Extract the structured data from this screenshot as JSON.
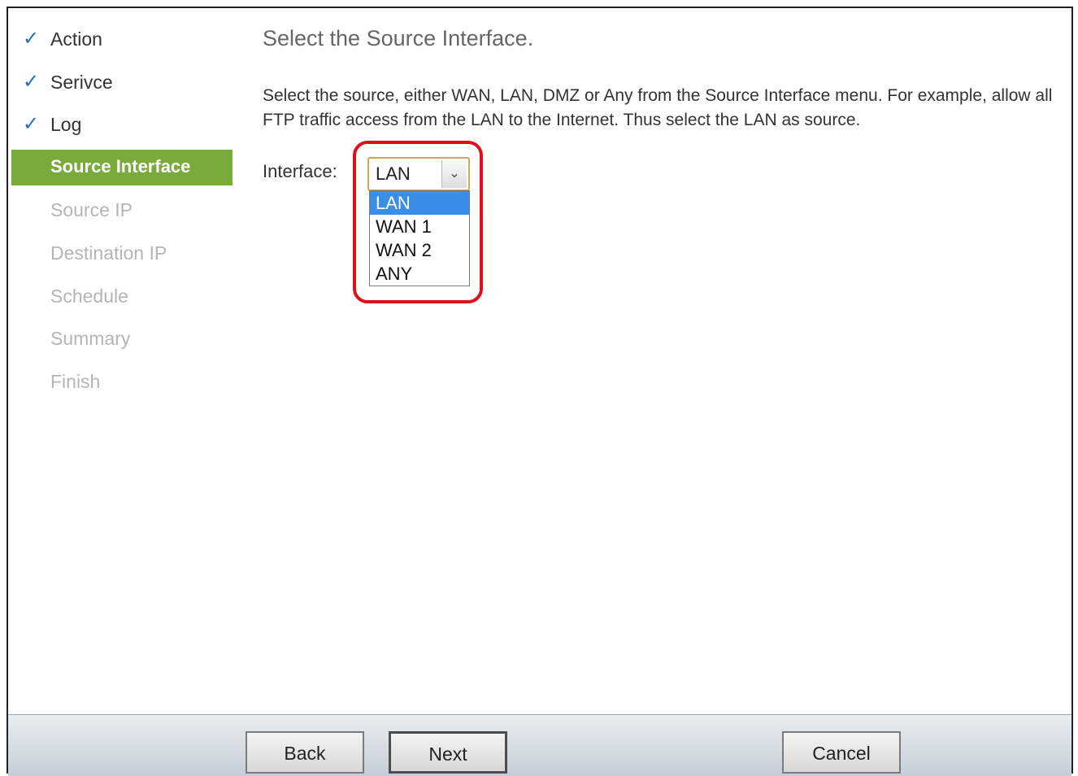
{
  "sidebar": {
    "items": [
      {
        "label": "Action",
        "state": "done"
      },
      {
        "label": "Serivce",
        "state": "done"
      },
      {
        "label": "Log",
        "state": "done"
      },
      {
        "label": "Source Interface",
        "state": "active"
      },
      {
        "label": "Source IP",
        "state": "pending"
      },
      {
        "label": "Destination IP",
        "state": "pending"
      },
      {
        "label": "Schedule",
        "state": "pending"
      },
      {
        "label": "Summary",
        "state": "pending"
      },
      {
        "label": "Finish",
        "state": "pending"
      }
    ],
    "check_icon": "checkmark-icon",
    "check_color": "#2a6db6",
    "active_color": "#7aa93c"
  },
  "main": {
    "title": "Select the Source Interface.",
    "description": "Select the source, either WAN, LAN, DMZ or Any from the Source Interface menu. For example, allow all FTP traffic access from the LAN to the Internet. Thus select the LAN as source.",
    "interface_label": "Interface:",
    "interface_select": {
      "value": "LAN",
      "options": [
        "LAN",
        "WAN 1",
        "WAN 2",
        "ANY"
      ],
      "highlighted": "LAN"
    },
    "highlight_color": "#e0101a"
  },
  "footer": {
    "back_label": "Back",
    "next_label": "Next",
    "cancel_label": "Cancel"
  }
}
